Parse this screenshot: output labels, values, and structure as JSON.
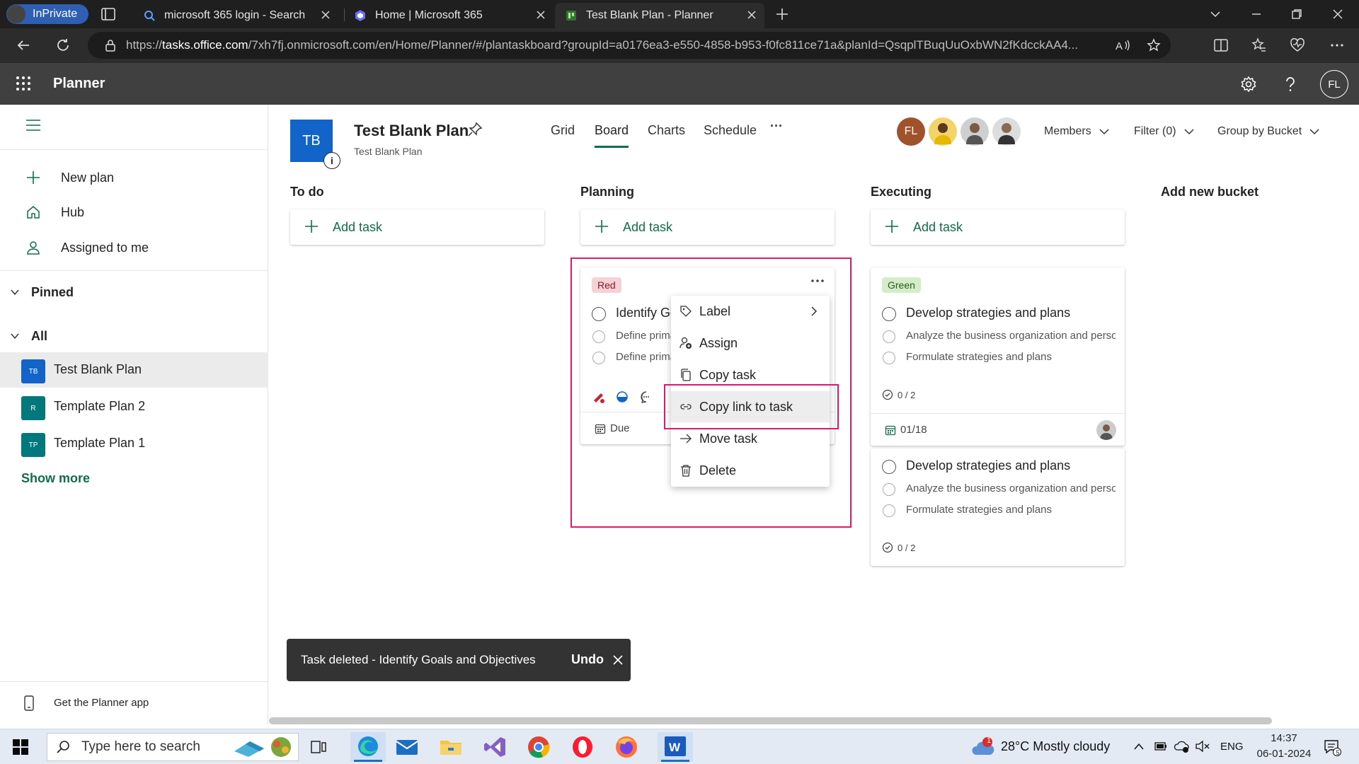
{
  "browser": {
    "inprivate_label": "InPrivate",
    "tabs": [
      {
        "title": "microsoft 365 login - Search"
      },
      {
        "title": "Home | Microsoft 365"
      },
      {
        "title": "Test Blank Plan - Planner"
      }
    ],
    "url_prefix": "https://",
    "url_host": "tasks.office.com",
    "url_rest": "/7xh7fj.onmicrosoft.com/en/Home/Planner/#/plantaskboard?groupId=a0176ea3-e550-4858-b953-f0fc811ce71a&planId=QsqplTBuqUuOxbWN2fKdcckAA4..."
  },
  "app": {
    "title": "Planner",
    "user_initials": "FL"
  },
  "sidebar": {
    "items": [
      {
        "label": "New plan",
        "icon": "plus-icon"
      },
      {
        "label": "Hub",
        "icon": "home-icon"
      },
      {
        "label": "Assigned to me",
        "icon": "person-icon"
      }
    ],
    "pinned_label": "Pinned",
    "all_label": "All",
    "plans": [
      {
        "badge": "TB",
        "label": "Test Blank Plan",
        "color": "#1364c9"
      },
      {
        "badge": "R",
        "label": "Template Plan 2",
        "color": "#03787c"
      },
      {
        "badge": "TP",
        "label": "Template Plan 1",
        "color": "#03787c"
      }
    ],
    "show_more": "Show more",
    "get_app": "Get the Planner app"
  },
  "plan": {
    "avatar": "TB",
    "name": "Test Blank Plan",
    "subtitle": "Test Blank Plan",
    "views": [
      "Grid",
      "Board",
      "Charts",
      "Schedule"
    ],
    "more": "···",
    "members_initials": "FL",
    "members_label": "Members",
    "filter_label": "Filter (0)",
    "group_label": "Group by Bucket"
  },
  "buckets": {
    "todo": "To do",
    "planning": "Planning",
    "executing": "Executing",
    "add_new": "Add new bucket",
    "add_task": "Add task"
  },
  "cards": {
    "planning": {
      "tag": "Red",
      "title": "Identify Goals and Objectives",
      "subtasks": [
        "Define primary goals",
        "Define primary objectives"
      ],
      "due": "Due"
    },
    "exec1": {
      "tag": "Green",
      "title": "Develop strategies and plans",
      "subtasks": [
        "Analyze the business organization and personnel",
        "Formulate strategies and plans"
      ],
      "progress": "0 / 2",
      "date": "01/18"
    },
    "exec2": {
      "title": "Develop strategies and plans",
      "subtasks": [
        "Analyze the business organization and personnel",
        "Formulate strategies and plans"
      ],
      "progress": "0 / 2"
    }
  },
  "context_menu": {
    "items": [
      {
        "label": "Label",
        "icon": "tag-icon"
      },
      {
        "label": "Assign",
        "icon": "assign-icon"
      },
      {
        "label": "Copy task",
        "icon": "copy-icon"
      },
      {
        "label": "Copy link to task",
        "icon": "link-icon"
      },
      {
        "label": "Move task",
        "icon": "arrow-right-icon"
      },
      {
        "label": "Delete",
        "icon": "trash-icon"
      }
    ]
  },
  "toast": {
    "message": "Task deleted - Identify Goals and Objectives",
    "undo": "Undo"
  },
  "taskbar": {
    "search_placeholder": "Type here to search",
    "weather": "28°C  Mostly cloudy",
    "weather_badge": "1",
    "lang": "ENG",
    "time": "14:37",
    "date": "06-01-2024",
    "notif_count": "5"
  },
  "colors": {
    "accent": "#0f6e4a",
    "highlight": "#e0176e",
    "red_tag": "#f6d1d5",
    "green_tag": "#d4ecc8"
  }
}
